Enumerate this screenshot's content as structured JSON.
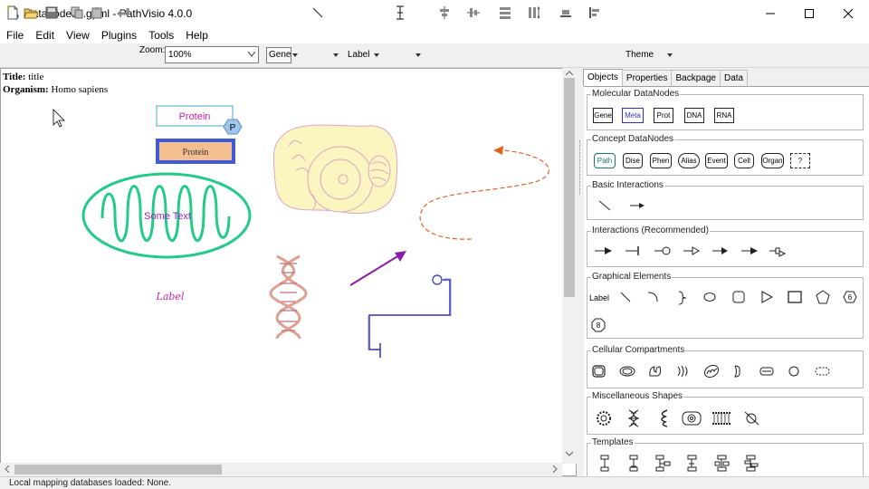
{
  "window": {
    "title": "datanodes2.gpml - PathVisio 4.0.0"
  },
  "menu": [
    "File",
    "Edit",
    "View",
    "Plugins",
    "Tools",
    "Help"
  ],
  "toolbar": {
    "zoom_label": "Zoom:",
    "zoom_value": "100%",
    "gene_combo": "Gene",
    "label_button": "Label",
    "theme_button": "Theme"
  },
  "pathway_info": {
    "title_key": "Title:",
    "title_value": "title",
    "organism_key": "Organism:",
    "organism_value": "Homo sapiens"
  },
  "canvas": {
    "protein_top_label": "Protein",
    "phospho_label": "P",
    "protein_box_label": "Protein",
    "mito_label": "Some Text",
    "free_label": "Label",
    "colors": {
      "protein_text": "#cc22aa",
      "protein_box_border": "#3d5bd8",
      "protein_box_fill": "#f4be8e",
      "mito": "#22cc88",
      "arrow": "#8a20a8",
      "curve": "#e06020",
      "shape": "#3030c0"
    }
  },
  "panel": {
    "tabs": [
      "Objects",
      "Properties",
      "Backpage",
      "Data"
    ],
    "active_tab": "Objects",
    "groups": {
      "molecular": {
        "title": "Molecular DataNodes",
        "items": [
          "Gene",
          "Meta",
          "Prot",
          "DNA",
          "RNA"
        ]
      },
      "concept": {
        "title": "Concept DataNodes",
        "items": [
          "Path",
          "Dise",
          "Phen",
          "Alias",
          "Event",
          "Cell",
          "Organ",
          "?"
        ]
      },
      "basic": {
        "title": "Basic Interactions"
      },
      "interactions": {
        "title": "Interactions (Recommended)"
      },
      "graphical": {
        "title": "Graphical Elements",
        "label": "Label"
      },
      "cellular": {
        "title": "Cellular Compartments"
      },
      "misc": {
        "title": "Miscellaneous Shapes"
      },
      "templates": {
        "title": "Templates"
      }
    }
  },
  "status": {
    "text": "Local mapping databases loaded: None."
  }
}
